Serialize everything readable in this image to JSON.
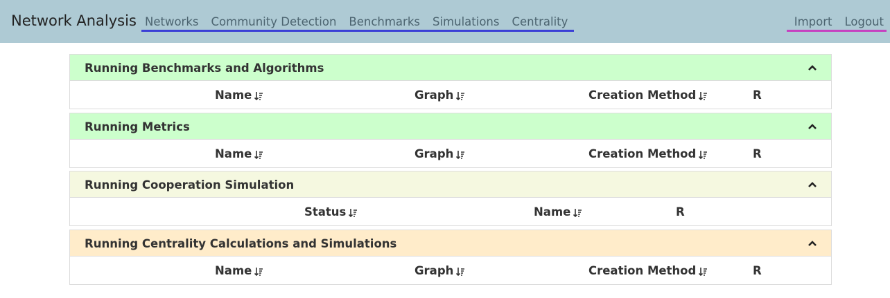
{
  "app": {
    "title": "Network Analysis"
  },
  "nav": {
    "main": [
      "Networks",
      "Community Detection",
      "Benchmarks",
      "Simulations",
      "Centrality"
    ],
    "right": [
      "Import",
      "Logout"
    ]
  },
  "panels": [
    {
      "title": "Running Benchmarks and Algorithms",
      "color": "#ccffcc",
      "columns": [
        "Name",
        "Graph",
        "Creation Method",
        "R"
      ]
    },
    {
      "title": "Running Metrics",
      "color": "#ccffcc",
      "columns": [
        "Name",
        "Graph",
        "Creation Method",
        "R"
      ]
    },
    {
      "title": "Running Cooperation Simulation",
      "color": "#f5f8e0",
      "columns": [
        "Status",
        "Name",
        "R"
      ]
    },
    {
      "title": "Running Centrality Calculations and Simulations",
      "color": "#ffecca",
      "columns": [
        "Name",
        "Graph",
        "Creation Method",
        "R"
      ]
    }
  ],
  "icons": {
    "collapse": "chevron-up-icon",
    "sort": "sort-descending-icon"
  }
}
